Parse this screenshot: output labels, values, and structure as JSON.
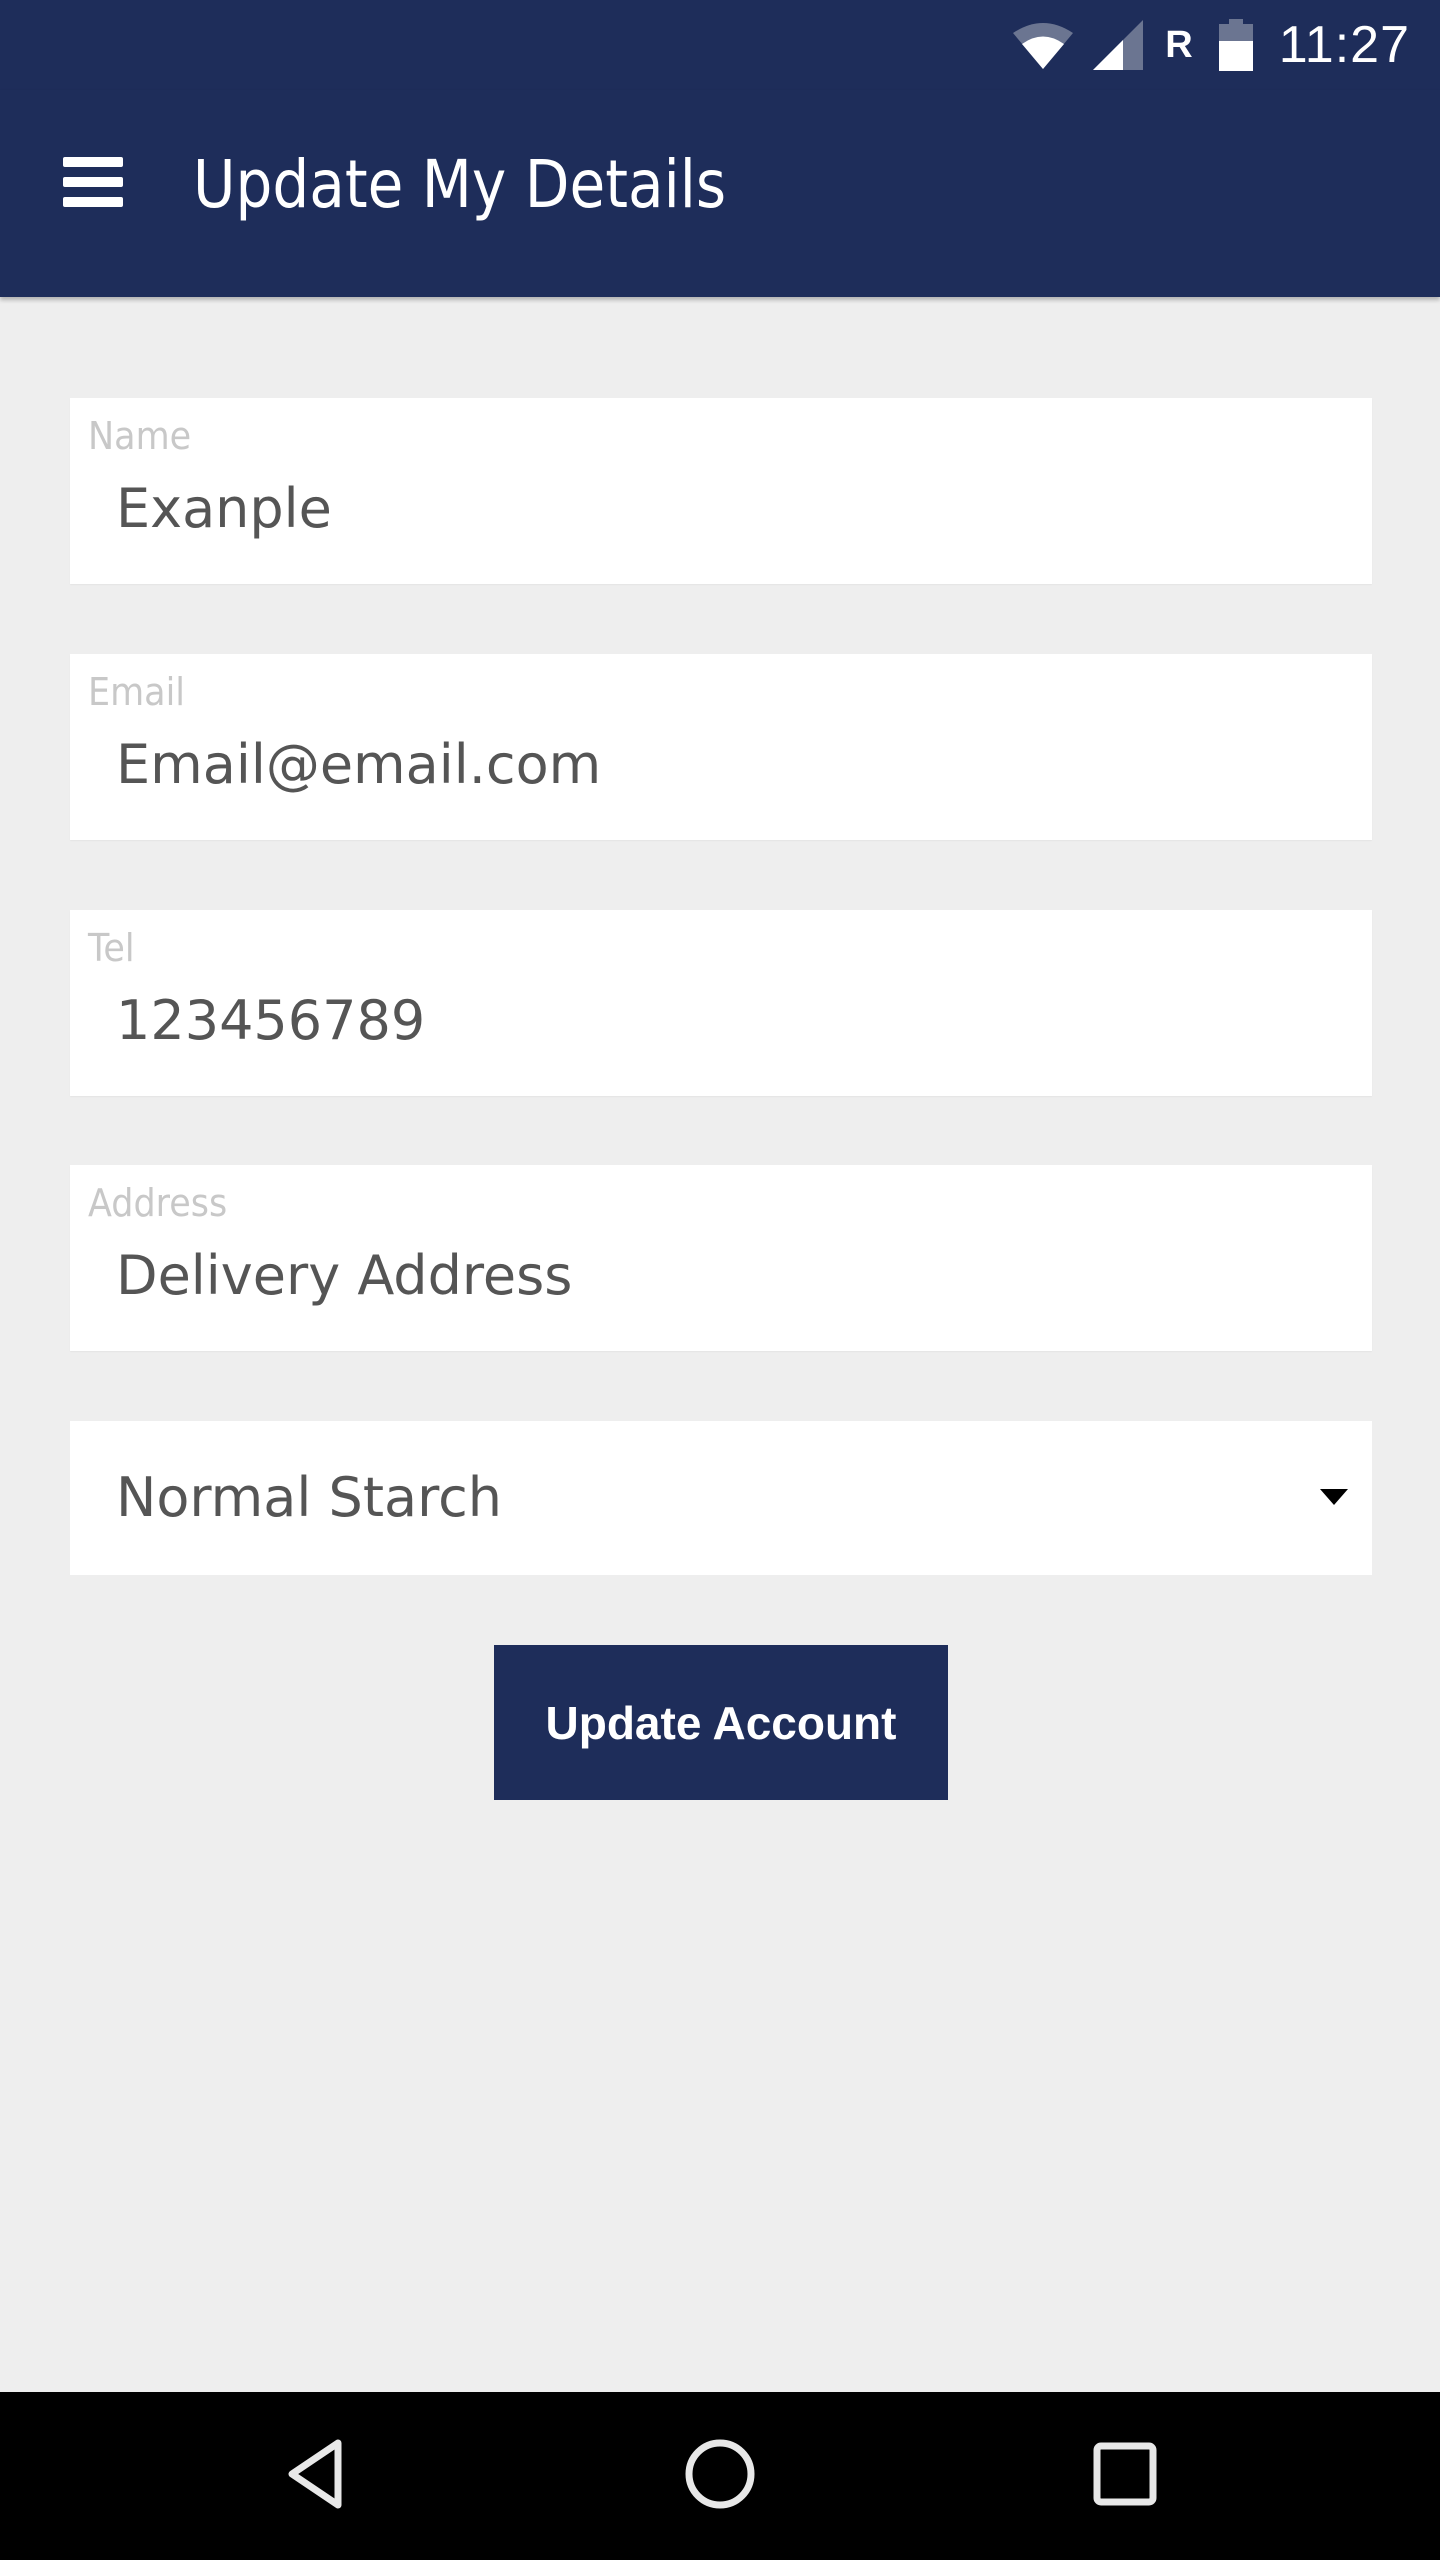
{
  "status_bar": {
    "time": "11:27",
    "roaming_indicator": "R",
    "icons": [
      "wifi-icon",
      "cell-signal-icon",
      "battery-icon"
    ]
  },
  "app_bar": {
    "menu_icon": "hamburger-menu-icon",
    "title": "Update My Details"
  },
  "form": {
    "fields": [
      {
        "label": "Name",
        "value": "Exanple"
      },
      {
        "label": "Email",
        "value": "Email@email.com"
      },
      {
        "label": "Tel",
        "value": "123456789"
      },
      {
        "label": "Address",
        "value": "Delivery Address"
      }
    ],
    "starch_select": {
      "selected": "Normal Starch",
      "icon": "dropdown-arrow-icon"
    },
    "submit_label": "Update Account"
  },
  "nav_bar": {
    "icons": [
      "back-icon",
      "home-icon",
      "recents-icon"
    ]
  },
  "colors": {
    "primary": "#1e2d5a",
    "background": "#eeeeee",
    "field_background": "#ffffff",
    "label_text": "#c8c8c8",
    "value_text": "#555555"
  }
}
